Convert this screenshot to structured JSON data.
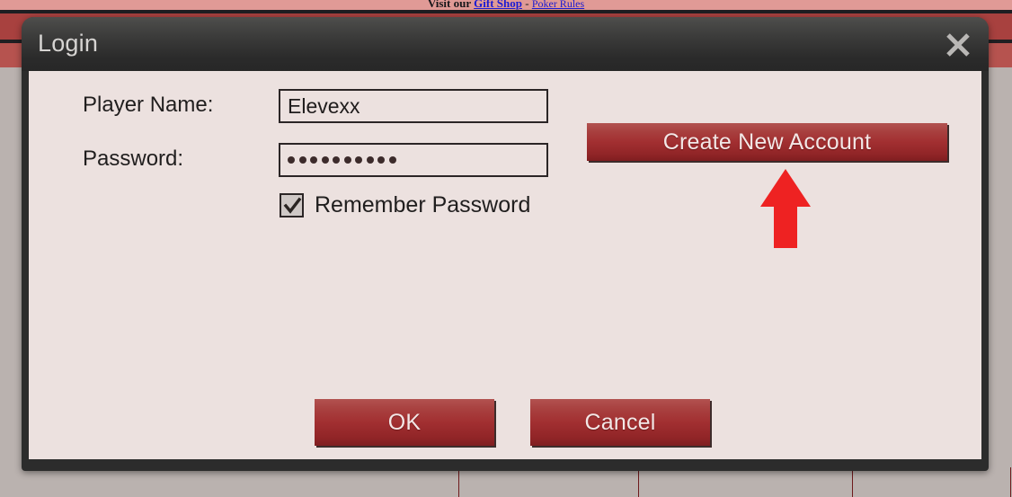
{
  "page": {
    "banner": {
      "prefix": "Visit our ",
      "link1": "Gift Shop",
      "separator": " - ",
      "link2": "Poker Rules"
    }
  },
  "dialog": {
    "title": "Login",
    "close_icon": "close-x-icon",
    "fields": {
      "player_name_label": "Player Name:",
      "player_name_value": "Elevexx",
      "player_name_placeholder": "",
      "password_label": "Password:",
      "password_value": "••••••••••",
      "password_dot_count": 10,
      "remember_label": "Remember Password",
      "remember_checked": true
    },
    "buttons": {
      "create_account": "Create New Account",
      "ok": "OK",
      "cancel": "Cancel"
    }
  },
  "annotation": {
    "arrow": "red-up-arrow",
    "color": "#ee2222"
  },
  "colors": {
    "dialog_frame": "#2c2c2c",
    "dialog_body": "#ece1df",
    "button_red": "#a22f31",
    "page_background": "#bab2af",
    "banner_pink": "#e09a96",
    "link_blue": "#1b1bd2"
  }
}
